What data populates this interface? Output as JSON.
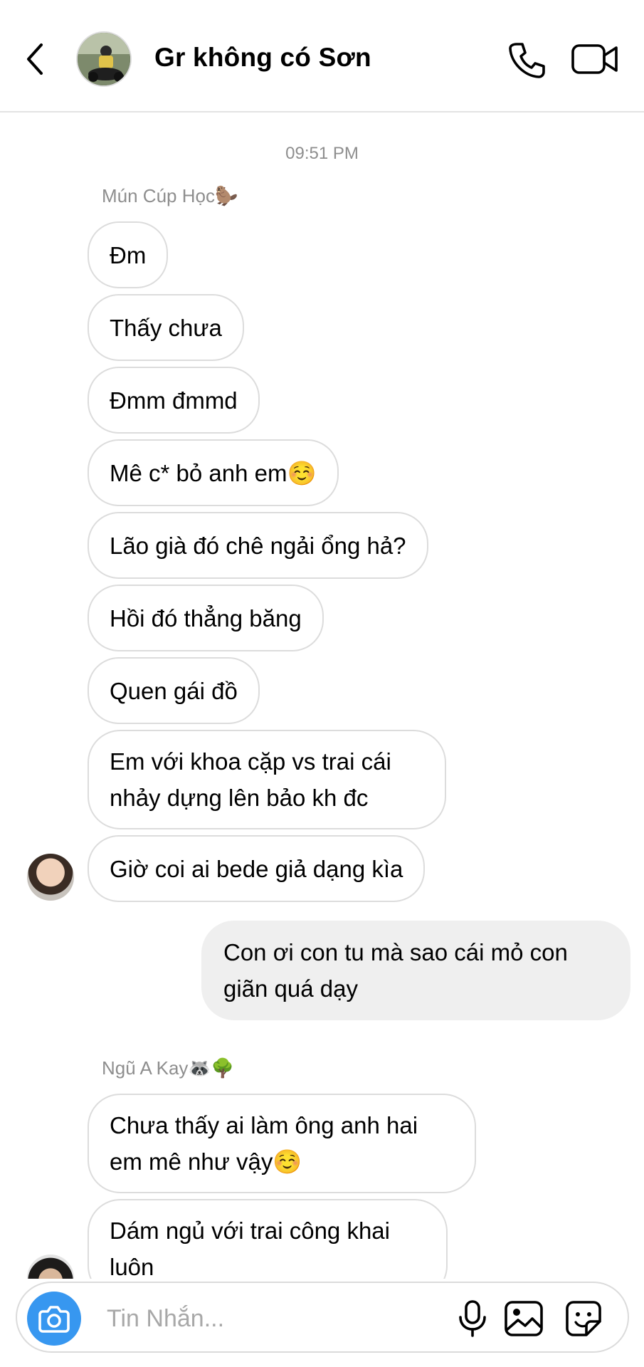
{
  "header": {
    "title": "Gr không có Sơn",
    "icons": {
      "back": "chevron-left-icon",
      "call": "phone-icon",
      "video": "video-camera-icon"
    }
  },
  "chat": {
    "timestamp": "09:51 PM",
    "group1": {
      "sender": "Mún Cúp Học🦫",
      "messages": [
        "Đm",
        "Thấy chưa",
        "Đmm đmmd",
        "Mê c* bỏ anh em☺️",
        "Lão già đó chê ngải ổng hả?",
        "Hồi đó thẳng băng",
        "Quen gái đồ",
        "Em với khoa cặp vs trai cái nhảy dựng lên bảo kh đc",
        "Giờ coi ai bede giả dạng kìa"
      ]
    },
    "outgoing": {
      "messages": [
        "Con ơi con tu mà sao cái mỏ con giãn quá dạy"
      ]
    },
    "group2": {
      "sender": "Ngũ A Kay🦝🌳",
      "messages": [
        "Chưa thấy ai làm ông anh hai em mê như vậy☺️",
        "Dám ngủ với trai công khai luôn"
      ]
    }
  },
  "composer": {
    "placeholder": "Tin Nhắn...",
    "icons": {
      "camera": "camera-icon",
      "mic": "microphone-icon",
      "gallery": "gallery-icon",
      "sticker": "sticker-icon"
    }
  },
  "colors": {
    "accent": "#3797f0",
    "incoming_border": "#dcdcdc",
    "outgoing_bg": "#efefef",
    "meta_text": "#8e8e8e"
  }
}
